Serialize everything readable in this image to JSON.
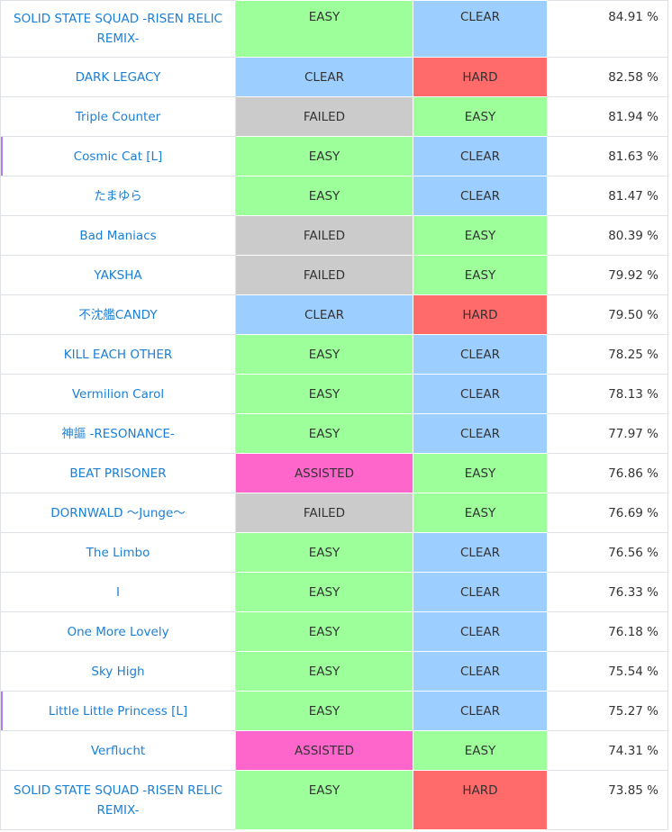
{
  "colors": {
    "link_text": "#1a7fd6",
    "lamp_easy": "#9cff9a",
    "lamp_clear": "#9ccfff",
    "lamp_hard": "#ff6a6a",
    "lamp_failed": "#cbcbcb",
    "lamp_assisted": "#ff66cc",
    "row_marker": "#b07cf0"
  },
  "rows": [
    {
      "title": "SOLID STATE SQUAD -RISEN RELIC REMIX-",
      "lamp1": "EASY",
      "lamp2": "CLEAR",
      "score": "84.91 %",
      "marked": false
    },
    {
      "title": "DARK LEGACY",
      "lamp1": "CLEAR",
      "lamp2": "HARD",
      "score": "82.58 %",
      "marked": false
    },
    {
      "title": "Triple Counter",
      "lamp1": "FAILED",
      "lamp2": "EASY",
      "score": "81.94 %",
      "marked": false
    },
    {
      "title": "Cosmic Cat [L]",
      "lamp1": "EASY",
      "lamp2": "CLEAR",
      "score": "81.63 %",
      "marked": true
    },
    {
      "title": "たまゆら",
      "lamp1": "EASY",
      "lamp2": "CLEAR",
      "score": "81.47 %",
      "marked": false
    },
    {
      "title": "Bad Maniacs",
      "lamp1": "FAILED",
      "lamp2": "EASY",
      "score": "80.39 %",
      "marked": false
    },
    {
      "title": "YAKSHA",
      "lamp1": "FAILED",
      "lamp2": "EASY",
      "score": "79.92 %",
      "marked": false
    },
    {
      "title": "不沈艦CANDY",
      "lamp1": "CLEAR",
      "lamp2": "HARD",
      "score": "79.50 %",
      "marked": false
    },
    {
      "title": "KILL EACH OTHER",
      "lamp1": "EASY",
      "lamp2": "CLEAR",
      "score": "78.25 %",
      "marked": false
    },
    {
      "title": "Vermilion Carol",
      "lamp1": "EASY",
      "lamp2": "CLEAR",
      "score": "78.13 %",
      "marked": false
    },
    {
      "title": "神謳 -RESONANCE-",
      "lamp1": "EASY",
      "lamp2": "CLEAR",
      "score": "77.97 %",
      "marked": false
    },
    {
      "title": "BEAT PRISONER",
      "lamp1": "ASSISTED",
      "lamp2": "EASY",
      "score": "76.86 %",
      "marked": false
    },
    {
      "title": "DORNWALD 〜Junge〜",
      "lamp1": "FAILED",
      "lamp2": "EASY",
      "score": "76.69 %",
      "marked": false
    },
    {
      "title": "The Limbo",
      "lamp1": "EASY",
      "lamp2": "CLEAR",
      "score": "76.56 %",
      "marked": false
    },
    {
      "title": "I",
      "lamp1": "EASY",
      "lamp2": "CLEAR",
      "score": "76.33 %",
      "marked": false
    },
    {
      "title": "One More Lovely",
      "lamp1": "EASY",
      "lamp2": "CLEAR",
      "score": "76.18 %",
      "marked": false
    },
    {
      "title": "Sky High",
      "lamp1": "EASY",
      "lamp2": "CLEAR",
      "score": "75.54 %",
      "marked": false
    },
    {
      "title": "Little Little Princess [L]",
      "lamp1": "EASY",
      "lamp2": "CLEAR",
      "score": "75.27 %",
      "marked": true
    },
    {
      "title": "Verflucht",
      "lamp1": "ASSISTED",
      "lamp2": "EASY",
      "score": "74.31 %",
      "marked": false
    },
    {
      "title": "SOLID STATE SQUAD -RISEN RELIC REMIX-",
      "lamp1": "EASY",
      "lamp2": "HARD",
      "score": "73.85 %",
      "marked": false
    }
  ]
}
